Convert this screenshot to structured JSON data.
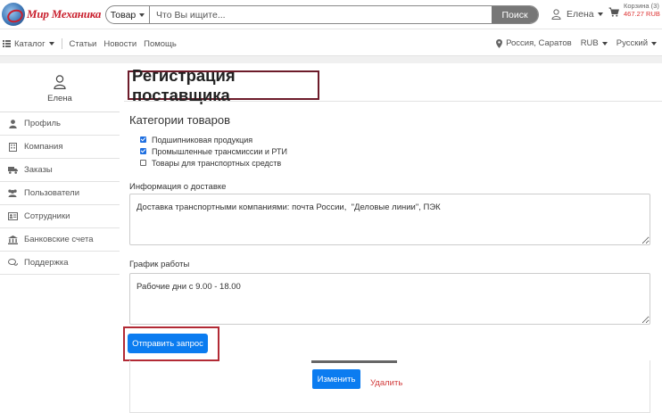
{
  "header": {
    "logo_text": "Мир Механика",
    "search": {
      "category": "Товар",
      "placeholder": "Что Вы ищите...",
      "button": "Поиск"
    },
    "user_name": "Елена",
    "cart": {
      "label": "Корзина (3)",
      "sum": "467.27 RUB"
    }
  },
  "nav": {
    "catalog": "Каталог",
    "links": [
      "Статьи",
      "Новости",
      "Помощь"
    ],
    "location": "Россия, Саратов",
    "currency": "RUB",
    "language": "Русский"
  },
  "sidebar": {
    "user_name": "Елена",
    "items": [
      {
        "label": "Профиль",
        "icon": "user-icon"
      },
      {
        "label": "Компания",
        "icon": "building-icon"
      },
      {
        "label": "Заказы",
        "icon": "truck-icon"
      },
      {
        "label": "Пользователи",
        "icon": "users-icon"
      },
      {
        "label": "Сотрудники",
        "icon": "id-card-icon"
      },
      {
        "label": "Банковские счета",
        "icon": "bank-icon"
      },
      {
        "label": "Поддержка",
        "icon": "chat-icon"
      }
    ]
  },
  "main": {
    "title": "Регистрация поставщика",
    "categories_heading": "Категории товаров",
    "categories": [
      {
        "label": "Подшипниковая продукция",
        "checked": true
      },
      {
        "label": "Промышленные трансмиссии и РТИ",
        "checked": true
      },
      {
        "label": "Товары для транспортных средств",
        "checked": false
      }
    ],
    "delivery_label": "Информация о доставке",
    "delivery_value": "Доставка транспортными компаниями: почта России,  \"Деловые линии\", ПЭК",
    "schedule_label": "График работы",
    "schedule_value": "Рабочие дни с 9.00 - 18.00",
    "submit": "Отправить запрос",
    "edit": "Изменить",
    "delete": "Удалить"
  },
  "colors": {
    "primary": "#0b7cf0",
    "logo": "#c9202e",
    "highlight_title": "#6d1b2a",
    "highlight_button": "#b22a35",
    "delete": "#d23b3b"
  }
}
